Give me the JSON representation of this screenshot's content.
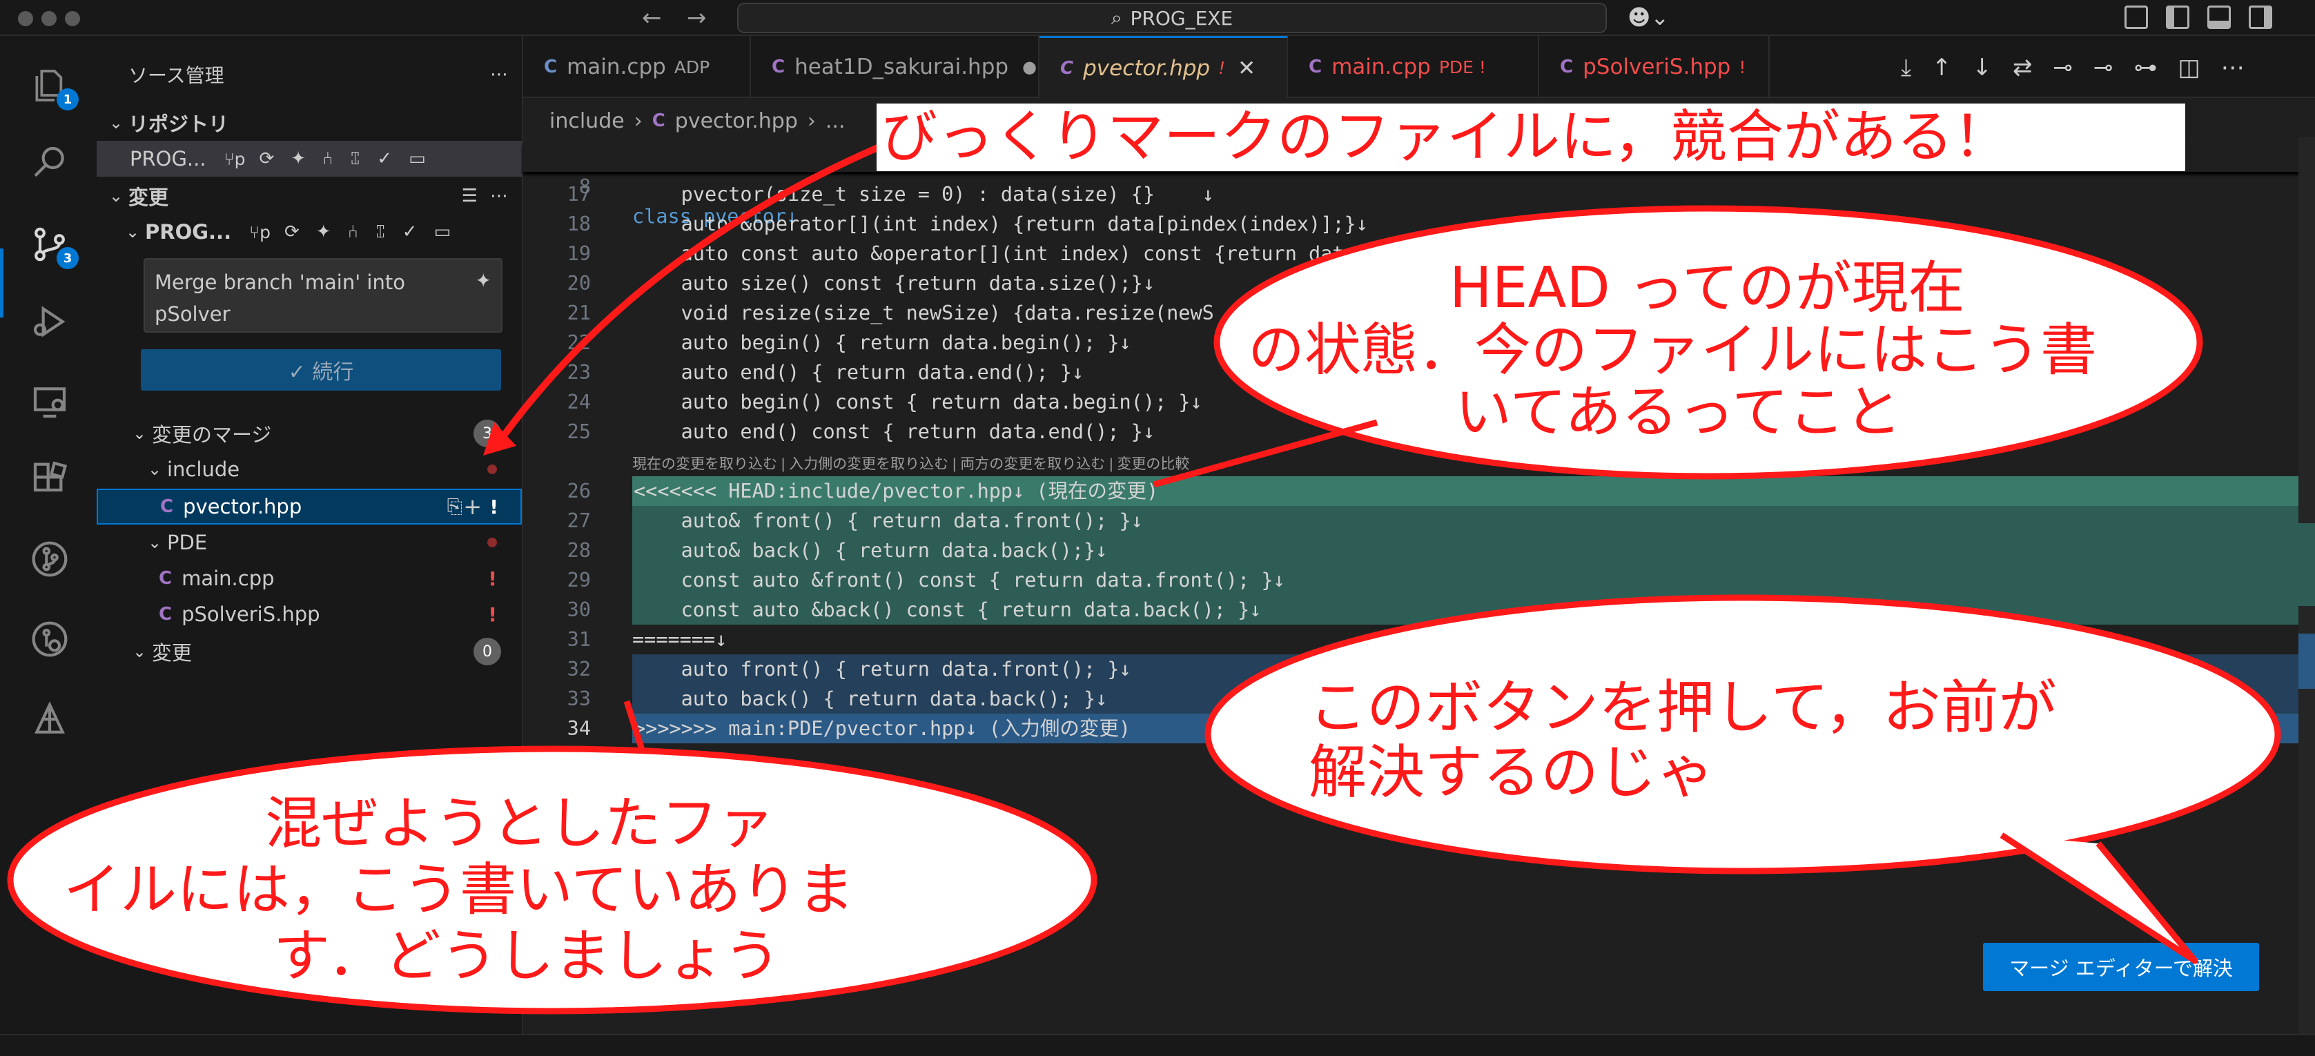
{
  "window": {
    "title": "PROG_EXE"
  },
  "activity_bar": {
    "explorer_badge": "1",
    "scm_badge": "3"
  },
  "sidebar": {
    "header": "ソース管理",
    "repositories_label": "リポジトリ",
    "repo_name": "PROG...",
    "branch_short": "p",
    "changes_label": "変更",
    "changes_repo_name": "PROG...",
    "commit_message_line1": "Merge branch 'main' into",
    "commit_message_line2": "pSolver",
    "commit_button": "✓ 続行",
    "merge_changes_label": "変更のマージ",
    "merge_changes_count": "3",
    "folder_include": "include",
    "file_pvector": "pvector.hpp",
    "pvector_status": "!",
    "folder_pde": "PDE",
    "file_main": "main.cpp",
    "main_status": "!",
    "file_psolver": "pSolveriS.hpp",
    "psolver_status": "!",
    "unstaged_label": "変更",
    "unstaged_count": "0"
  },
  "tabs": [
    {
      "label": "main.cpp",
      "sub": "ADP"
    },
    {
      "label": "heat1D_sakurai.hpp",
      "sub": ""
    },
    {
      "label": "pvector.hpp",
      "sub": "!"
    },
    {
      "label": "main.cpp",
      "sub": "PDE !"
    },
    {
      "label": "pSolveriS.hpp",
      "sub": "!"
    }
  ],
  "breadcrumb": {
    "folder": "include",
    "file": "pvector.hpp",
    "more": "..."
  },
  "editor": {
    "sticky_line_no": "8",
    "sticky_line": "class pvector↓",
    "lines": [
      {
        "no": "17",
        "text": "    pvector(size_t size = 0) : data(size) {}    ↓"
      },
      {
        "no": "18",
        "text": "    auto &operator[](int index) {return data[pindex(index)];}↓"
      },
      {
        "no": "19",
        "text": "    auto const auto &operator[](int index) const {return data[pi"
      },
      {
        "no": "20",
        "text": "    auto size() const {return data.size();}↓"
      },
      {
        "no": "21",
        "text": "    void resize(size_t newSize) {data.resize(newS"
      },
      {
        "no": "22",
        "text": "    auto begin() { return data.begin(); }↓"
      },
      {
        "no": "23",
        "text": "    auto end() { return data.end(); }↓"
      },
      {
        "no": "24",
        "text": "    auto begin() const { return data.begin(); }↓"
      },
      {
        "no": "25",
        "text": "    auto end() const { return data.end(); }↓"
      },
      {
        "no": "26",
        "text": "<<<<<<< HEAD:include/pvector.hpp↓ (現在の変更)"
      },
      {
        "no": "27",
        "text": "    auto& front() { return data.front(); }↓"
      },
      {
        "no": "28",
        "text": "    auto& back() { return data.back();}↓"
      },
      {
        "no": "29",
        "text": "    const auto &front() const { return data.front(); }↓"
      },
      {
        "no": "30",
        "text": "    const auto &back() const { return data.back(); }↓"
      },
      {
        "no": "31",
        "text": "=======↓"
      },
      {
        "no": "32",
        "text": "    auto front() { return data.front(); }↓"
      },
      {
        "no": "33",
        "text": "    auto back() { return data.back(); }↓"
      },
      {
        "no": "34",
        "text": ">>>>>>> main:PDE/pvector.hpp↓ (入力側の変更)"
      }
    ],
    "codelens": "現在の変更を取り込む | 入力側の変更を取り込む | 両方の変更を取り込む | 変更の比較"
  },
  "resolve_button": "マージ エディターで解決",
  "annotations": {
    "top": "びっくりマークのファイルに，競合がある！",
    "head_line1": "HEAD ってのが現在",
    "head_line2": "の状態．今のファイルにはこう書",
    "head_line3": "いてあるってこと",
    "button_line1": "このボタンを押して，お前が",
    "button_line2": "解決するのじゃ",
    "merge_line1": "混ぜようとしたファ",
    "merge_line2": "イルには，こう書いていありま",
    "merge_line3": "す．どうしましょう"
  },
  "colors": {
    "accent": "#0078d4",
    "annotation_red": "#ff1a1a",
    "conflict_red": "#f14c4c",
    "current_change_bg": "#2e5d55",
    "incoming_change_bg": "#24405a"
  }
}
